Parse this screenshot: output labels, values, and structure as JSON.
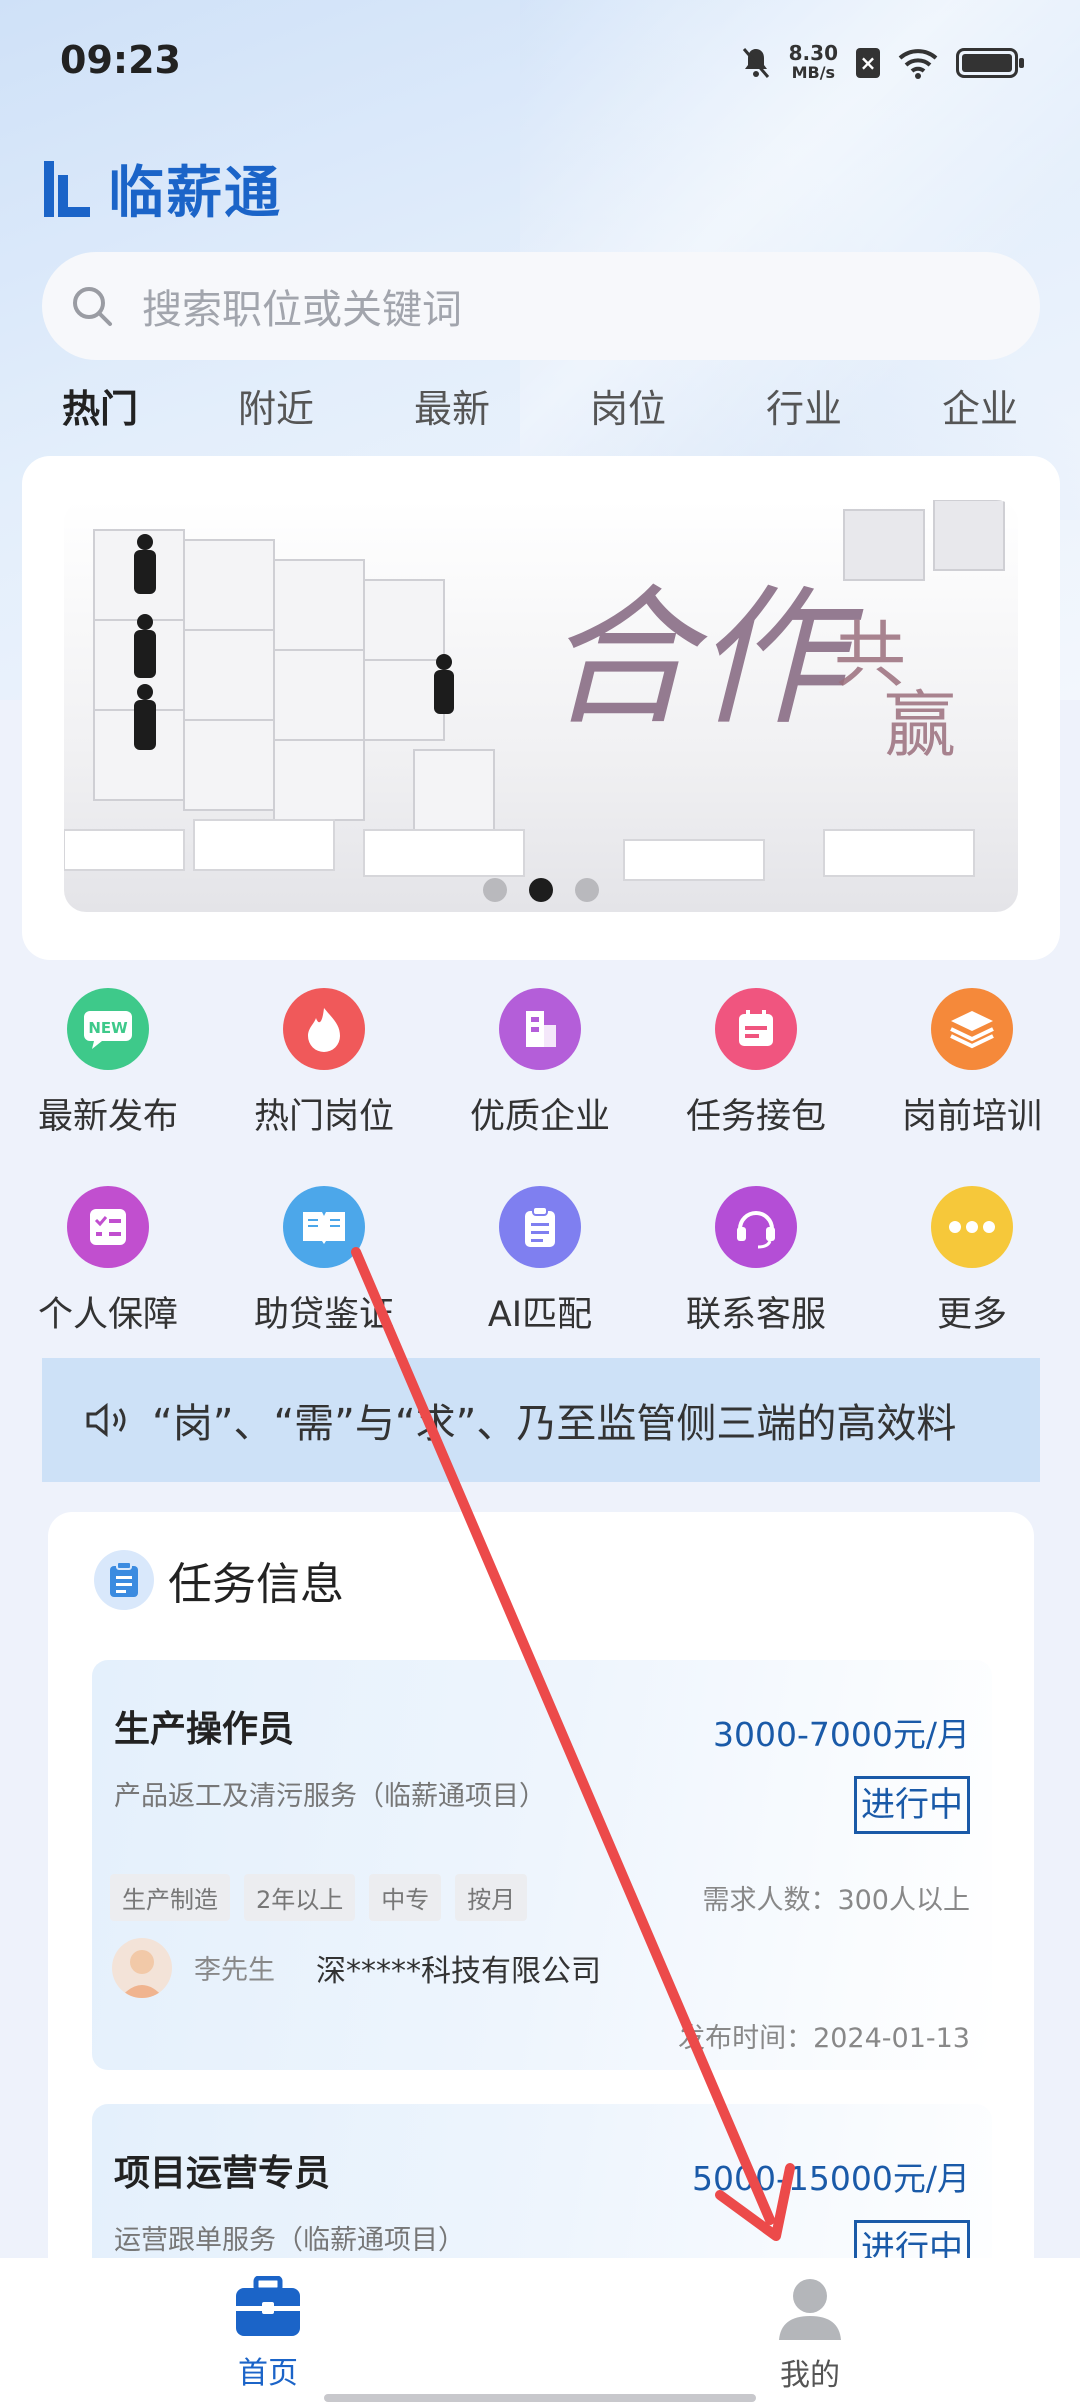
{
  "status_bar": {
    "time": "09:23",
    "net_speed_value": "8.30",
    "net_speed_unit": "MB/s",
    "icons": [
      "mute-icon",
      "sim-off-icon",
      "wifi-icon",
      "battery-icon"
    ]
  },
  "app": {
    "name": "临薪通",
    "brand_color": "#1b64c8"
  },
  "search": {
    "placeholder": "搜索职位或关键词"
  },
  "tabs": [
    "热门",
    "附近",
    "最新",
    "岗位",
    "行业",
    "企业"
  ],
  "banner": {
    "alt_icon": "puzzle-cooperation-illustration",
    "slides": 3,
    "active_slide": 2
  },
  "quick_menu": [
    {
      "label": "最新发布",
      "icon": "new-badge-icon",
      "color": "#3ec98a"
    },
    {
      "label": "热门岗位",
      "icon": "flame-icon",
      "color": "#f0595a"
    },
    {
      "label": "优质企业",
      "icon": "building-icon",
      "color": "#b45ed9"
    },
    {
      "label": "任务接包",
      "icon": "calendar-icon",
      "color": "#f0557f"
    },
    {
      "label": "岗前培训",
      "icon": "layers-icon",
      "color": "#f5893a"
    },
    {
      "label": "个人保障",
      "icon": "checklist-icon",
      "color": "#c14fcf"
    },
    {
      "label": "助贷鉴证",
      "icon": "book-icon",
      "color": "#4ca7ea"
    },
    {
      "label": "AI匹配",
      "icon": "clipboard-icon",
      "color": "#7f7ff0"
    },
    {
      "label": "联系客服",
      "icon": "headset-icon",
      "color": "#b44ed6"
    },
    {
      "label": "更多",
      "icon": "more-dots-icon",
      "color": "#f6c83a"
    }
  ],
  "notice": {
    "text": "“岗”、“需”与“求”、乃至监管侧三端的高效料"
  },
  "tasks": {
    "title": "任务信息",
    "items": [
      {
        "name": "生产操作员",
        "salary": "3000-7000元/月",
        "subtitle": "产品返工及清污服务（临薪通项目）",
        "status": "进行中",
        "tags": [
          "生产制造",
          "2年以上",
          "中专",
          "按月"
        ],
        "demand": "需求人数：300人以上",
        "contact": "李先生",
        "company": "深*****科技有限公司",
        "date": "发布时间：2024-01-13"
      },
      {
        "name": "项目运营专员",
        "salary": "5000-15000元/月",
        "subtitle": "运营跟单服务（临薪通项目）",
        "status": "进行中"
      }
    ]
  },
  "bottom_nav": [
    {
      "label": "首页",
      "icon": "briefcase-icon",
      "active": true
    },
    {
      "label": "我的",
      "icon": "user-icon",
      "active": false
    }
  ]
}
